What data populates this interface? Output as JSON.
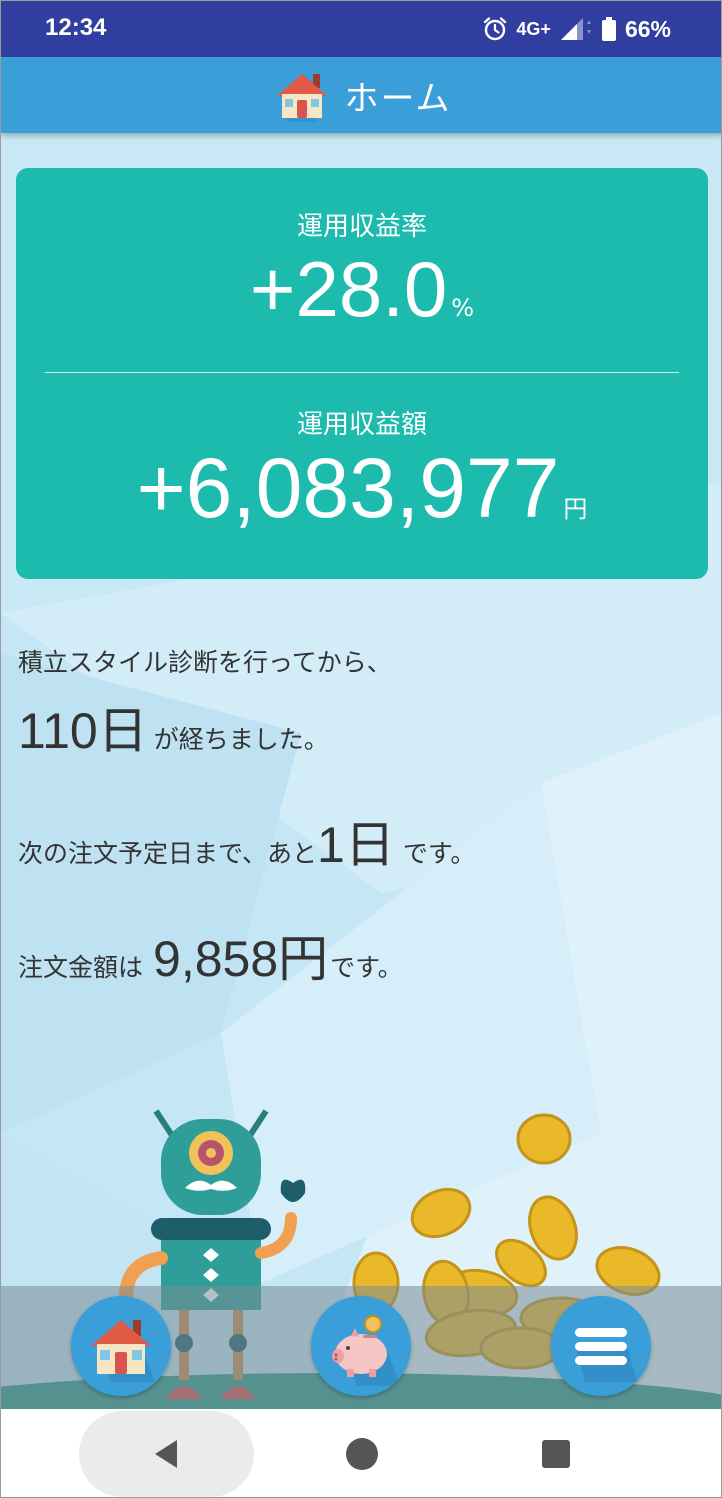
{
  "status_bar": {
    "time": "12:34",
    "network": "4G+",
    "battery": "66%",
    "icons": [
      "alarm-icon",
      "signal-icon",
      "battery-icon"
    ]
  },
  "header": {
    "title": "ホーム",
    "icon": "house-icon"
  },
  "summary": {
    "rate_label": "運用収益率",
    "rate_value": "+28.0",
    "rate_unit": "%",
    "amount_label": "運用収益額",
    "amount_value": "+6,083,977",
    "amount_unit": "円"
  },
  "info": {
    "line1": "積立スタイル診断を行ってから、",
    "days_elapsed": "110日",
    "line2_suffix": "が経ちました。",
    "next_order_prefix": "次の注文予定日まで、あと",
    "next_order_days": "1日",
    "next_order_suffix": "です。",
    "order_amount_prefix": "注文金額は",
    "order_amount_value": "9,858円",
    "order_amount_suffix": "です。"
  },
  "bottom_nav": {
    "items": [
      "home-icon",
      "piggy-bank-icon",
      "menu-icon"
    ]
  },
  "system_nav": {
    "items": [
      "back-icon",
      "home-circle-icon",
      "recents-icon"
    ]
  },
  "colors": {
    "status_bar": "#303f9f",
    "header": "#3a9ed8",
    "card": "#1dbbad",
    "background": "#c5e6f4"
  }
}
